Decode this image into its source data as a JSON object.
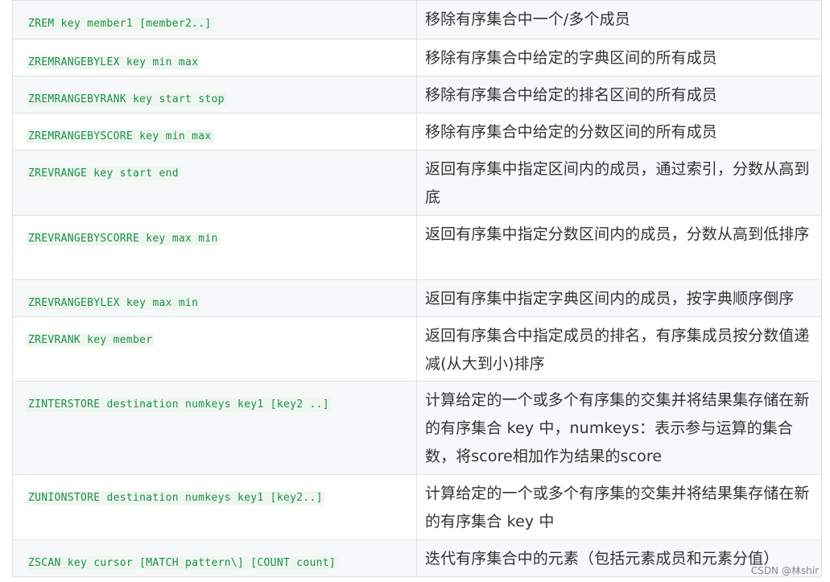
{
  "rows": [
    {
      "command": "ZREM key member1 [member2..]",
      "description": "移除有序集合中一个/多个成员"
    },
    {
      "command": "ZREMRANGEBYLEX key min max",
      "description": "移除有序集合中给定的字典区间的所有成员"
    },
    {
      "command": "ZREMRANGEBYRANK key start stop",
      "description": "移除有序集合中给定的排名区间的所有成员"
    },
    {
      "command": "ZREMRANGEBYSCORE key min max",
      "description": "移除有序集合中给定的分数区间的所有成员"
    },
    {
      "command": "ZREVRANGE key start end",
      "description": "返回有序集中指定区间内的成员，通过索引，分数从高到底"
    },
    {
      "command": "ZREVRANGEBYSCORRE key max min",
      "description": "返回有序集中指定分数区间内的成员，分数从高到低排序"
    },
    {
      "command": "ZREVRANGEBYLEX key max min",
      "description": "返回有序集中指定字典区间内的成员，按字典顺序倒序"
    },
    {
      "command": "ZREVRANK key member",
      "description": "返回有序集合中指定成员的排名，有序集成员按分数值递减(从大到小)排序"
    },
    {
      "command": "ZINTERSTORE destination numkeys key1 [key2 ..]",
      "description": "计算给定的一个或多个有序集的交集并将结果集存储在新的有序集合 key 中，numkeys：表示参与运算的集合数，将score相加作为结果的score"
    },
    {
      "command": "ZUNIONSTORE destination numkeys key1 [key2..]",
      "description": "计算给定的一个或多个有序集的交集并将结果集存储在新的有序集合 key 中"
    },
    {
      "command": "ZSCAN key cursor [MATCH pattern\\] [COUNT count]",
      "description": "迭代有序集合中的元素（包括元素成员和元素分值）"
    }
  ],
  "watermark": "CSDN @林shir",
  "colors": {
    "command_text": "#1c8f46",
    "row_stripe": "#f6f8fa",
    "border": "#dfe2e5"
  }
}
